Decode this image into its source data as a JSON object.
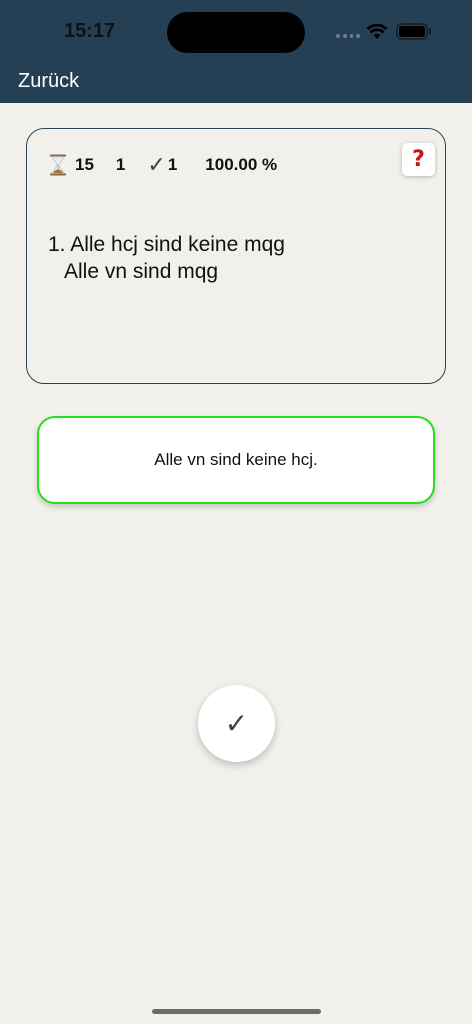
{
  "status_bar": {
    "time": "15:17"
  },
  "nav": {
    "back_label": "Zurück"
  },
  "stats": {
    "time": "15",
    "count": "1",
    "check_glyph": "✓",
    "correct": "1",
    "percent": "100.00 %"
  },
  "help": {
    "label": "?"
  },
  "question": {
    "line1": "1. Alle hcj sind keine mqg",
    "line2": "Alle vn sind mqg"
  },
  "answer": {
    "label": "Alle vn sind keine hcj."
  },
  "confirm": {
    "label": "✓"
  },
  "colors": {
    "header": "#253f55",
    "background": "#f2f0eb",
    "answer_border": "#22e01c",
    "help_mark": "#c81414"
  }
}
